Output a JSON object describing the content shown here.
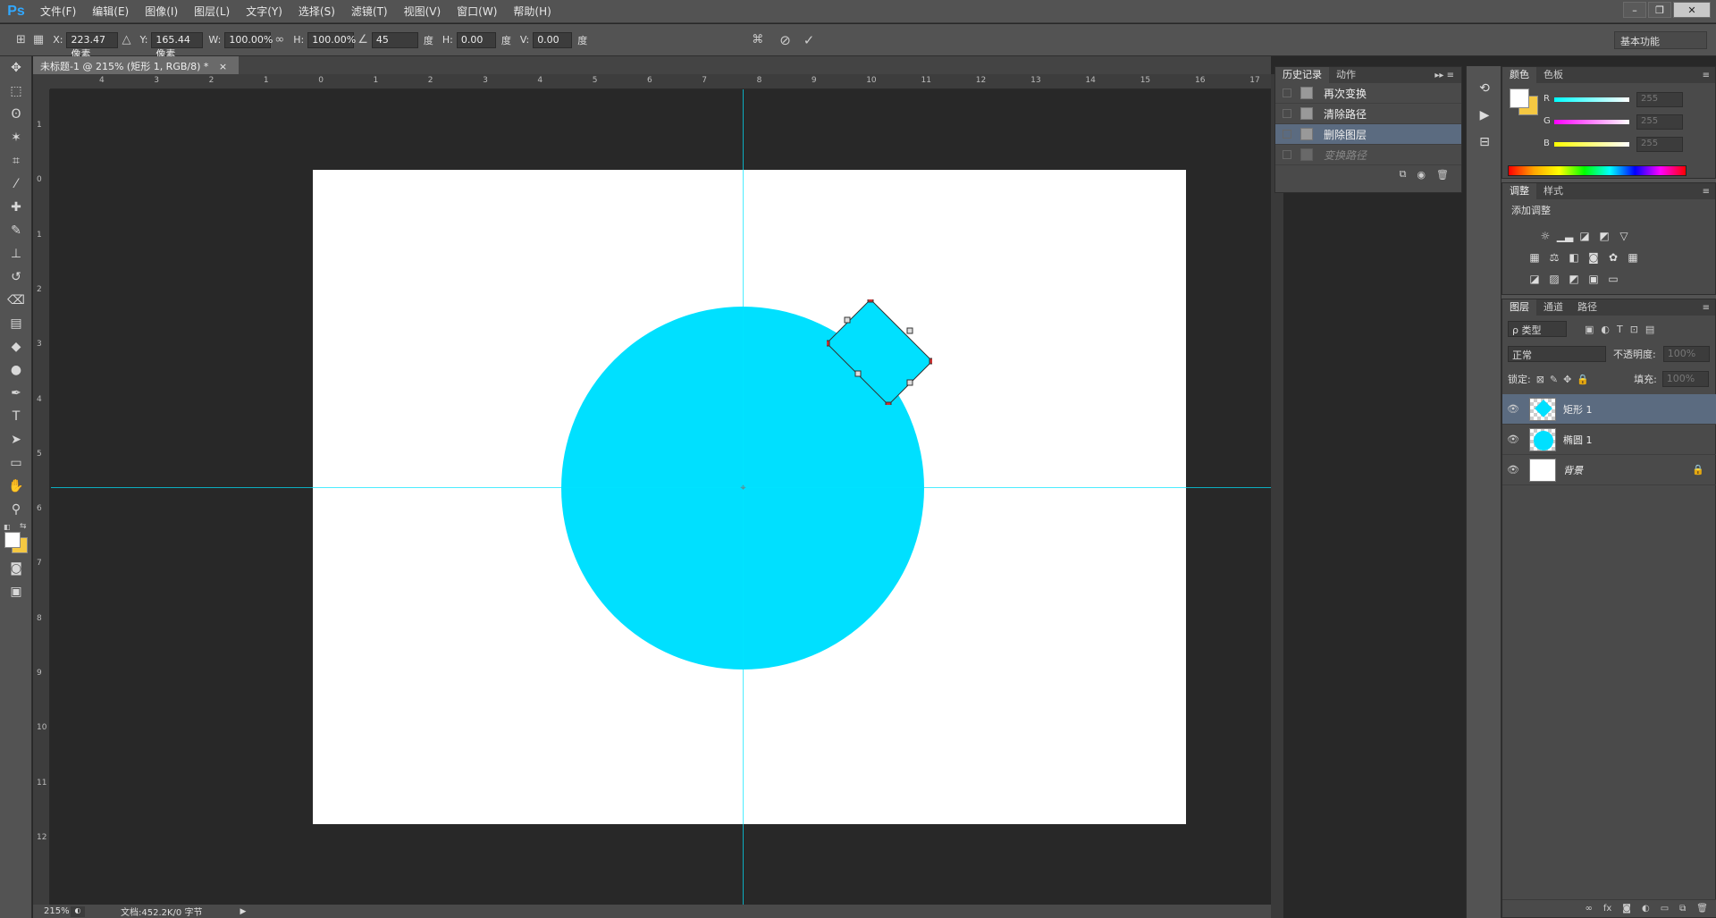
{
  "app": {
    "logo": "Ps"
  },
  "menu": [
    "文件(F)",
    "编辑(E)",
    "图像(I)",
    "图层(L)",
    "文字(Y)",
    "选择(S)",
    "滤镜(T)",
    "视图(V)",
    "窗口(W)",
    "帮助(H)"
  ],
  "window_controls": [
    "–",
    "❐",
    "✕"
  ],
  "options": {
    "x_label": "X:",
    "x_value": "223.47 像素",
    "y_label": "Y:",
    "y_value": "165.44 像素",
    "w_label": "W:",
    "w_value": "100.00%",
    "h_label": "H:",
    "h_value": "100.00%",
    "angle_value": "45",
    "angle_unit": "度",
    "hskew_label": "H:",
    "hskew_value": "0.00",
    "hskew_unit": "度",
    "vskew_label": "V:",
    "vskew_value": "0.00",
    "vskew_unit": "度",
    "workspace": "基本功能"
  },
  "document": {
    "tab_title": "未标题-1 @ 215% (矩形 1, RGB/8) *",
    "close": "×"
  },
  "ruler_top_ticks": [
    "4",
    "3",
    "2",
    "1",
    "0",
    "1",
    "2",
    "3",
    "4",
    "5",
    "6",
    "7",
    "8",
    "9",
    "10",
    "11",
    "12",
    "13",
    "14",
    "15",
    "16",
    "17"
  ],
  "ruler_left_ticks": [
    "1",
    "0",
    "1",
    "2",
    "3",
    "4",
    "5",
    "6",
    "7",
    "8",
    "9",
    "10",
    "11",
    "12"
  ],
  "status": {
    "zoom": "215%",
    "doc_info": "文档:452.2K/0 字节"
  },
  "history_panel": {
    "tabs": [
      "历史记录",
      "动作"
    ],
    "items": [
      {
        "label": "再次变换",
        "state": "normal"
      },
      {
        "label": "清除路径",
        "state": "normal"
      },
      {
        "label": "删除图层",
        "state": "selected"
      },
      {
        "label": "变换路径",
        "state": "dim"
      }
    ]
  },
  "color_panel": {
    "tabs": [
      "颜色",
      "色板"
    ],
    "channels": [
      {
        "label": "R",
        "value": "255",
        "color": "#00ffff"
      },
      {
        "label": "G",
        "value": "255",
        "color": "#ff00ff"
      },
      {
        "label": "B",
        "value": "255",
        "color": "#ffff00"
      }
    ]
  },
  "adjust_panel": {
    "tabs": [
      "调整",
      "样式"
    ],
    "title": "添加调整"
  },
  "layers_panel": {
    "tabs": [
      "图层",
      "通道",
      "路径"
    ],
    "filter": "ρ 类型",
    "blend_mode": "正常",
    "opacity_label": "不透明度:",
    "opacity_value": "100%",
    "lock_label": "锁定:",
    "fill_label": "填充:",
    "fill_value": "100%",
    "layers": [
      {
        "name": "矩形 1",
        "selected": true,
        "thumb": "rect"
      },
      {
        "name": "椭圆 1",
        "selected": false,
        "thumb": "circle"
      },
      {
        "name": "背景",
        "selected": false,
        "thumb": "white",
        "locked": true
      }
    ]
  },
  "colors": {
    "cyan_shape": "#00e0ff",
    "guide": "#00e6ff",
    "panel_bg": "#535353",
    "selection": "#5b6b80",
    "fg_swatch": "#ffffff",
    "bg_swatch": "#f5c842"
  }
}
